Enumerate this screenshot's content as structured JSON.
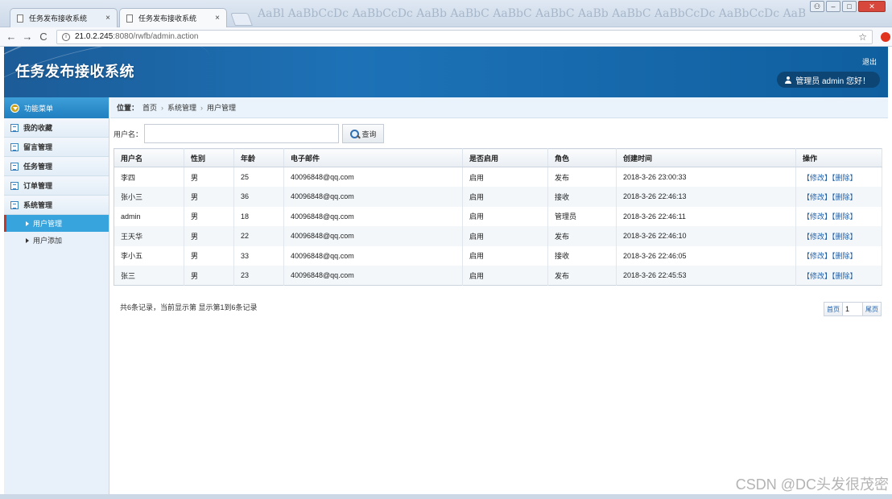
{
  "browser": {
    "tabs": [
      {
        "title": "任务发布接收系统",
        "close": "×"
      },
      {
        "title": "任务发布接收系统",
        "close": "×"
      }
    ],
    "nav": {
      "back": "←",
      "forward": "→",
      "reload": "C"
    },
    "url": {
      "host": "21.0.2.245",
      "rest": ":8080/rwfb/admin.action"
    },
    "bg_text": "AaBl AaBbCcDc AaBbCcDc AaBb AaBbC AaBbC AaBbC AaBb AaBbC AaBbCcDc AaBbCcDc AaBbCcDc",
    "icons": {
      "star": "☆",
      "info": "i"
    },
    "window": {
      "minimize": "–",
      "maximize": "□",
      "close": "✕",
      "user": "⚇"
    }
  },
  "header": {
    "title": "任务发布接收系统",
    "logout": "退出",
    "user_greeting": "管理员 admin 您好！"
  },
  "sidebar": {
    "menu_title": "功能菜单",
    "groups": [
      {
        "label": "我的收藏"
      },
      {
        "label": "留言管理"
      },
      {
        "label": "任务管理"
      },
      {
        "label": "订单管理"
      },
      {
        "label": "系统管理"
      }
    ],
    "sub_items": [
      {
        "label": "用户管理"
      },
      {
        "label": "用户添加"
      }
    ]
  },
  "breadcrumb": {
    "label": "位置：",
    "items": [
      "首页",
      "系统管理",
      "用户管理"
    ],
    "sep": "›"
  },
  "search": {
    "label": "用户名：",
    "value": "",
    "placeholder": "",
    "button": "查询"
  },
  "table": {
    "columns": [
      "用户名",
      "性别",
      "年龄",
      "电子邮件",
      "是否启用",
      "角色",
      "创建时间",
      "操作"
    ],
    "rows": [
      [
        "李四",
        "男",
        "25",
        "40096848@qq.com",
        "启用",
        "发布",
        "2018-3-26 23:00:33"
      ],
      [
        "张小三",
        "男",
        "36",
        "40096848@qq.com",
        "启用",
        "接收",
        "2018-3-26 22:46:13"
      ],
      [
        "admin",
        "男",
        "18",
        "40096848@qq.com",
        "启用",
        "管理员",
        "2018-3-26 22:46:11"
      ],
      [
        "王天华",
        "男",
        "22",
        "40096848@qq.com",
        "启用",
        "发布",
        "2018-3-26 22:46:10"
      ],
      [
        "李小五",
        "男",
        "33",
        "40096848@qq.com",
        "启用",
        "接收",
        "2018-3-26 22:46:05"
      ],
      [
        "张三",
        "男",
        "23",
        "40096848@qq.com",
        "启用",
        "发布",
        "2018-3-26 22:45:53"
      ]
    ],
    "edit_label": "【修改】",
    "delete_label": "【删除】"
  },
  "pagination": {
    "summary": "共6条记录，当前显示第  显示第1到6条记录",
    "first": "首页",
    "page": "1",
    "last": "尾页"
  },
  "watermark": "CSDN @DC头发很茂密",
  "colors": {
    "header_blue": "#1d72b7",
    "menu_active": "#38a4dd",
    "link": "#1f5fa8"
  }
}
